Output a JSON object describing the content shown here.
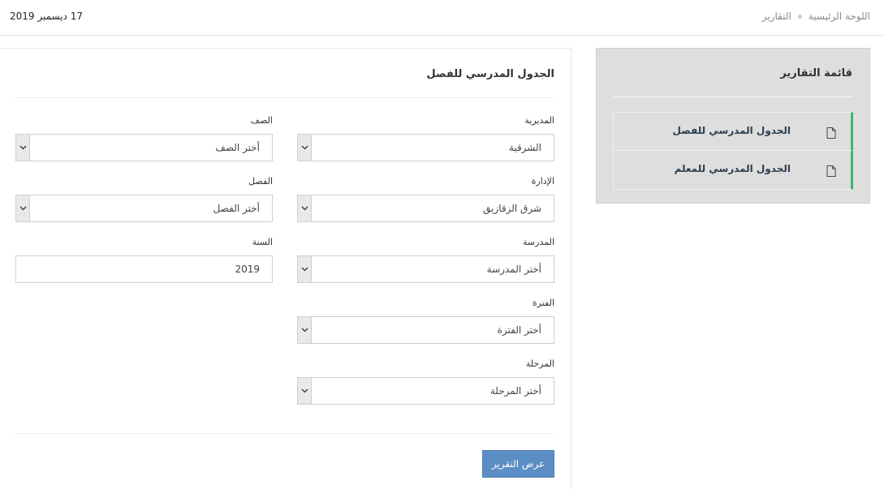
{
  "header": {
    "date": "17 ديسمبر 2019",
    "breadcrumb": [
      "اللوحة الرئيسية",
      "التقارير"
    ]
  },
  "sidebar": {
    "title": "قائمة التقارير",
    "items": [
      {
        "label": "الجدول المدرسي للفصل",
        "icon": "document-icon"
      },
      {
        "label": "الجدول المدرسي للمعلم",
        "icon": "document-icon"
      }
    ],
    "accent_color": "#3cb371"
  },
  "form": {
    "title": "الجدول المدرسي للفصل",
    "fields": {
      "directorate": {
        "label": "المديرية",
        "value": "الشرقية"
      },
      "grade": {
        "label": "الصف",
        "value": "أختر الصف"
      },
      "administration": {
        "label": "الإدارة",
        "value": "شرق الزقازيق"
      },
      "class": {
        "label": "الفصل",
        "value": "أختر الفصل"
      },
      "school": {
        "label": "المدرسة",
        "value": "أختر المدرسة"
      },
      "year": {
        "label": "السنة",
        "value": "2019"
      },
      "period": {
        "label": "الفترة",
        "value": "أختر الفترة"
      },
      "stage": {
        "label": "المرحلة",
        "value": "أختر المرحلة"
      }
    },
    "submit_label": "عرض التقرير",
    "button_color": "#5b8ec4"
  }
}
